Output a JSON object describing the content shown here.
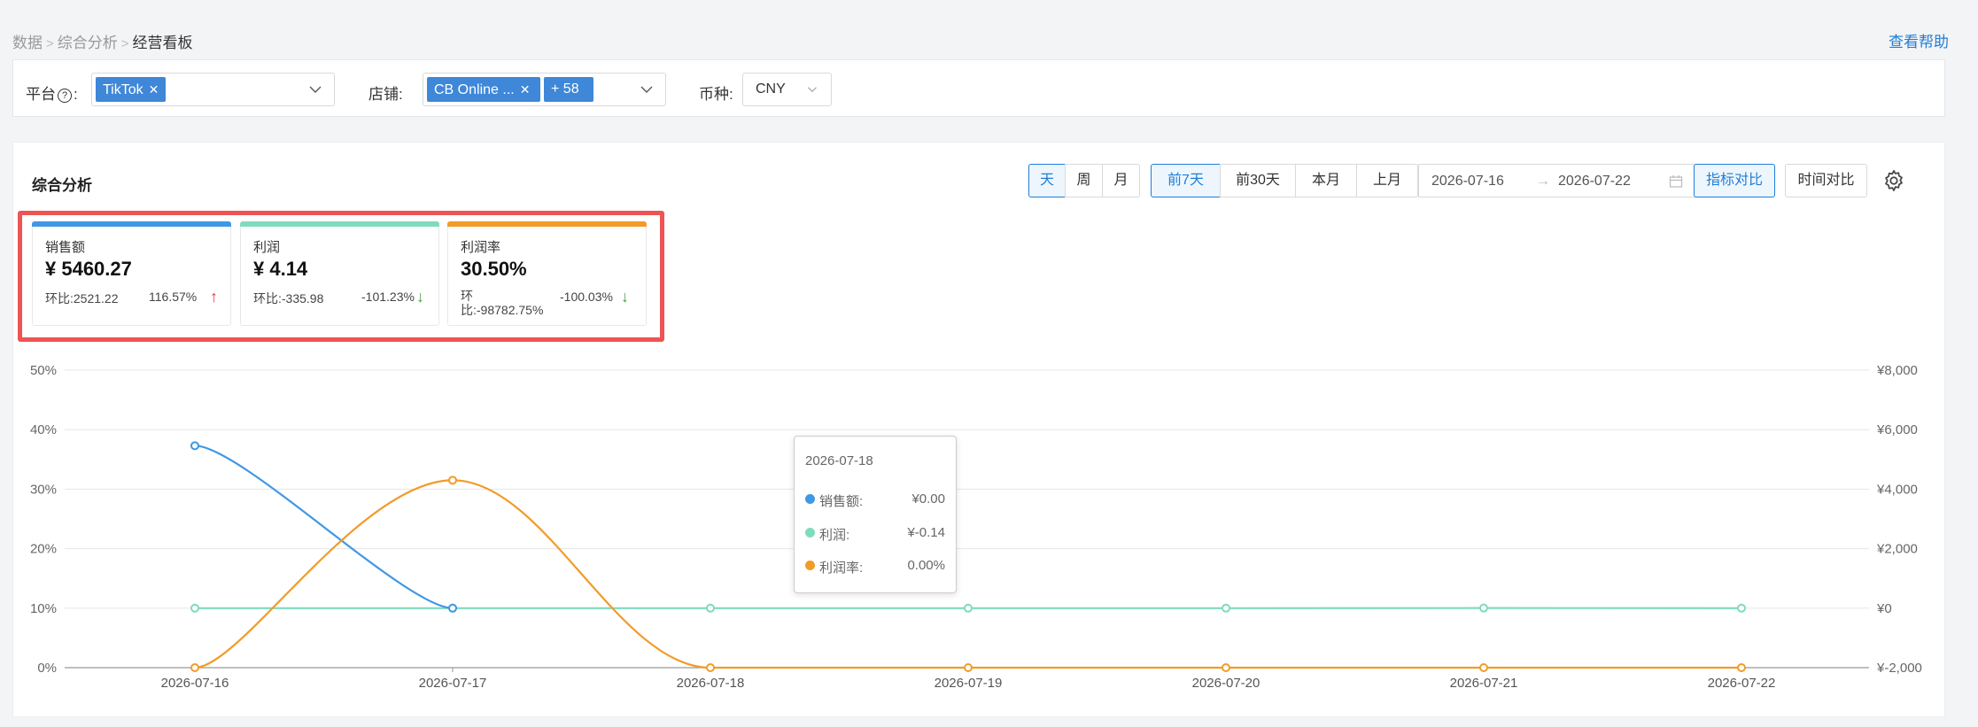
{
  "breadcrumb": {
    "item1": "数据",
    "item2": "综合分析",
    "current": "经营看板",
    "sep": ">"
  },
  "help_link": "查看帮助",
  "filters": {
    "platform_label": "平台",
    "platform_help": "?",
    "platform_colon": ":",
    "platform_tag": "TikTok",
    "shop_label": "店铺:",
    "shop_tag": "CB Online ...",
    "shop_more": "+ 58",
    "currency_label": "币种:",
    "currency_value": "CNY"
  },
  "section_title": "综合分析",
  "granularity": {
    "day": "天",
    "week": "周",
    "month": "月"
  },
  "ranges": {
    "last7": "前7天",
    "last30": "前30天",
    "this_month": "本月",
    "last_month": "上月"
  },
  "date_range": {
    "start": "2026-07-16",
    "arrow": "→",
    "end": "2026-07-22"
  },
  "actions": {
    "metric_compare": "指标对比",
    "time_compare": "时间对比"
  },
  "kpis": [
    {
      "name": "销售额",
      "value": "¥ 5460.27",
      "compare_label": "环比:",
      "compare_value": "2521.22",
      "pct": "116.57%",
      "trend": "↑",
      "color": "#3f97e5"
    },
    {
      "name": "利润",
      "value": "¥ 4.14",
      "compare_label": "环比:",
      "compare_value": "-335.98",
      "pct": "-101.23%",
      "trend": "↓",
      "color": "#7fdbbd"
    },
    {
      "name": "利润率",
      "value": "30.50%",
      "compare_label_1": "环",
      "compare_label_2": "比:",
      "compare_value": "-98782.75%",
      "pct": "-100.03%",
      "trend": "↓",
      "color": "#f29b28"
    }
  ],
  "chart_data": {
    "type": "line",
    "x": [
      "2026-07-16",
      "2026-07-17",
      "2026-07-18",
      "2026-07-19",
      "2026-07-20",
      "2026-07-21",
      "2026-07-22"
    ],
    "y_left_ticks": [
      "0%",
      "10%",
      "20%",
      "30%",
      "40%",
      "50%"
    ],
    "y_left_range": [
      0,
      50
    ],
    "y_right_ticks": [
      "¥-2,000",
      "¥0",
      "¥2,000",
      "¥4,000",
      "¥6,000",
      "¥8,000"
    ],
    "y_right_range": [
      -2000,
      8000
    ],
    "grid": true,
    "series": [
      {
        "name": "销售额",
        "axis": "right",
        "color": "#3f97e5",
        "values": [
          5460.27,
          0,
          null,
          null,
          null,
          null,
          null
        ]
      },
      {
        "name": "利润",
        "axis": "right",
        "color": "#7fdbbd",
        "values": [
          0,
          0,
          -0.14,
          0,
          0,
          4.28,
          0
        ]
      },
      {
        "name": "利润率",
        "axis": "left",
        "color": "#f29b28",
        "values": [
          0,
          31.5,
          0,
          0,
          0,
          0,
          0
        ]
      }
    ],
    "tooltip": {
      "date": "2026-07-18",
      "rows": [
        {
          "label": "销售额:",
          "value": "¥0.00",
          "color": "#3f97e5"
        },
        {
          "label": "利润:",
          "value": "¥-0.14",
          "color": "#7fdbbd"
        },
        {
          "label": "利润率:",
          "value": "0.00%",
          "color": "#f29b28"
        }
      ]
    }
  }
}
